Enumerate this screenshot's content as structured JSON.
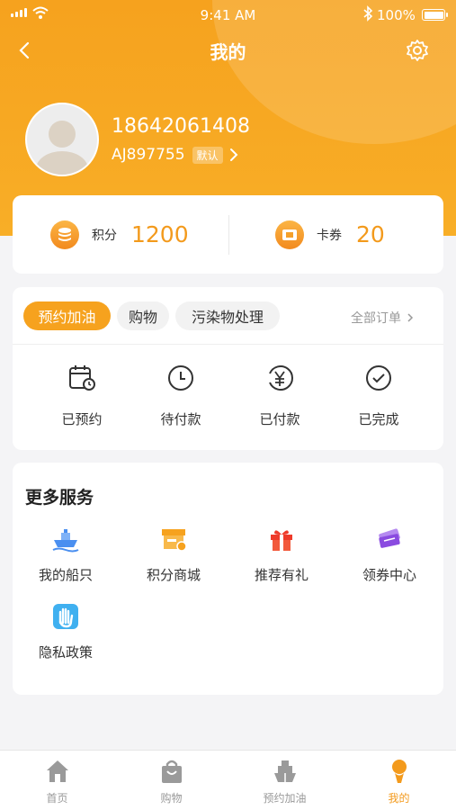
{
  "status_bar": {
    "time": "9:41 AM",
    "battery": "100%"
  },
  "nav": {
    "title": "我的"
  },
  "profile": {
    "phone": "18642061408",
    "user_id": "AJ897755",
    "default_tag": "默认"
  },
  "points": [
    {
      "label": "积分",
      "value": "1200",
      "icon": "coins-icon"
    },
    {
      "label": "卡券",
      "value": "20",
      "icon": "ticket-icon"
    }
  ],
  "orders": {
    "tabs": [
      {
        "label": "预约加油",
        "active": true
      },
      {
        "label": "购物",
        "active": false
      },
      {
        "label": "污染物处理",
        "active": false
      }
    ],
    "all_orders": "全部订单",
    "statuses": [
      {
        "label": "已预约",
        "icon": "calendar-clock-icon"
      },
      {
        "label": "待付款",
        "icon": "clock-icon"
      },
      {
        "label": "已付款",
        "icon": "yen-icon"
      },
      {
        "label": "已完成",
        "icon": "check-circle-icon"
      }
    ]
  },
  "services": {
    "title": "更多服务",
    "items": [
      {
        "label": "我的船只",
        "icon": "ship-icon",
        "color": "#4a8ff0"
      },
      {
        "label": "积分商城",
        "icon": "shop-icon",
        "color": "#f6a21e"
      },
      {
        "label": "推荐有礼",
        "icon": "gift-icon",
        "color": "#ee3a2a"
      },
      {
        "label": "领券中心",
        "icon": "coupon-icon",
        "color": "#8a4be0"
      },
      {
        "label": "隐私政策",
        "icon": "hand-icon",
        "color": "#3fb0f0"
      }
    ]
  },
  "tabbar": [
    {
      "label": "首页",
      "icon": "home-icon",
      "active": false
    },
    {
      "label": "购物",
      "icon": "shopping-bag-icon",
      "active": false
    },
    {
      "label": "预约加油",
      "icon": "boat-icon",
      "active": false
    },
    {
      "label": "我的",
      "icon": "user-icon",
      "active": true
    }
  ],
  "colors": {
    "accent": "#f6a21e",
    "accent_text": "#f39a1c"
  }
}
